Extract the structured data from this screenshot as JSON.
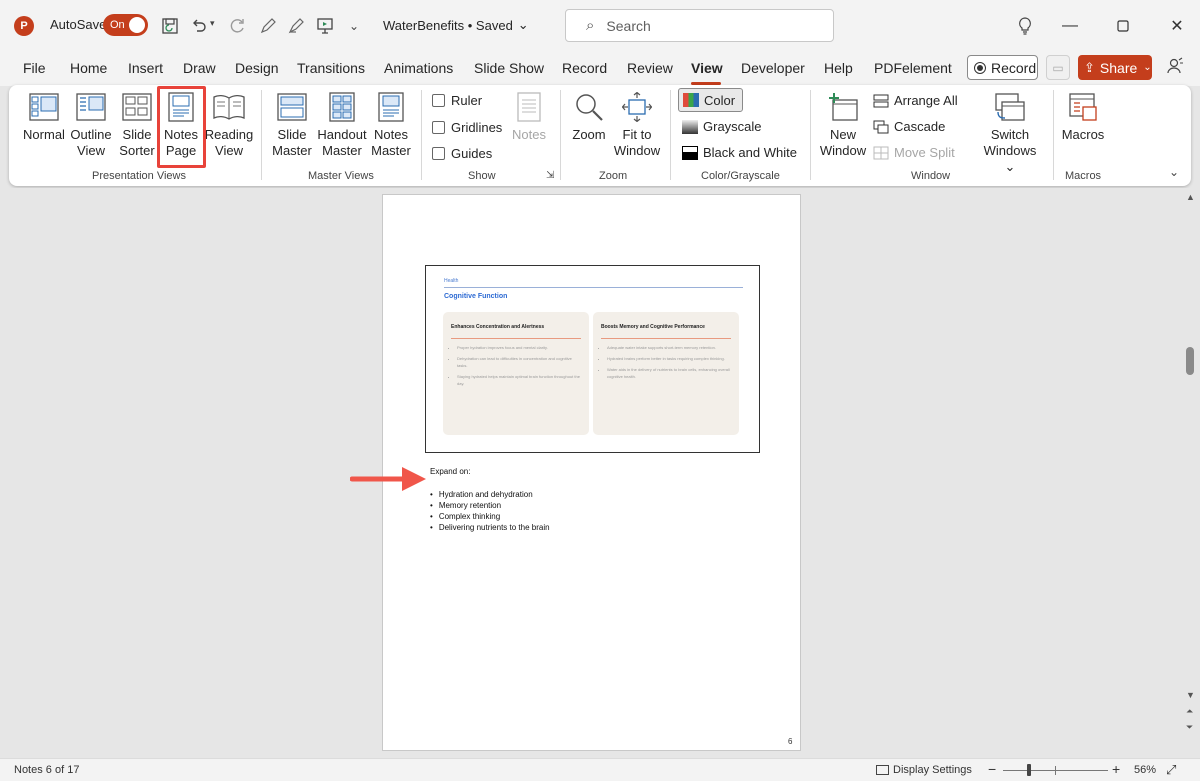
{
  "titlebar": {
    "logo_letter": "P",
    "autosave_label": "AutoSave",
    "autosave_state": "On",
    "doc_title": "WaterBenefits • Saved",
    "title_chevron": "⌄",
    "search_placeholder": "Search",
    "icons": [
      "save-icon",
      "undo-icon",
      "redo-icon",
      "pen-icon",
      "highlighter-icon",
      "present-icon",
      "customize-icon",
      "lightbulb-icon",
      "minimize-icon",
      "maximize-icon",
      "close-icon"
    ]
  },
  "tabs": [
    "File",
    "Home",
    "Insert",
    "Draw",
    "Design",
    "Transitions",
    "Animations",
    "Slide Show",
    "Record",
    "Review",
    "View",
    "Developer",
    "Help",
    "PDFelement"
  ],
  "active_tab": "View",
  "record_button": "Record",
  "share_button": "Share",
  "ribbon": {
    "presentation_views": {
      "label": "Presentation Views",
      "buttons": [
        {
          "l1": "Normal",
          "l2": ""
        },
        {
          "l1": "Outline",
          "l2": "View"
        },
        {
          "l1": "Slide",
          "l2": "Sorter"
        },
        {
          "l1": "Notes",
          "l2": "Page"
        },
        {
          "l1": "Reading",
          "l2": "View"
        }
      ]
    },
    "master_views": {
      "label": "Master Views",
      "buttons": [
        {
          "l1": "Slide",
          "l2": "Master"
        },
        {
          "l1": "Handout",
          "l2": "Master"
        },
        {
          "l1": "Notes",
          "l2": "Master"
        }
      ]
    },
    "show": {
      "label": "Show",
      "checkboxes": [
        "Ruler",
        "Gridlines",
        "Guides"
      ],
      "notes_button": "Notes"
    },
    "zoom": {
      "label": "Zoom",
      "zoom_button": "Zoom",
      "fit_l1": "Fit to",
      "fit_l2": "Window"
    },
    "color_grayscale": {
      "label": "Color/Grayscale",
      "options": [
        "Color",
        "Grayscale",
        "Black and White"
      ]
    },
    "window": {
      "label": "Window",
      "new_l1": "New",
      "new_l2": "Window",
      "arrange_all": "Arrange All",
      "cascade": "Cascade",
      "move_split": "Move Split",
      "switch_l1": "Switch",
      "switch_l2": "Windows ⌄"
    },
    "macros": {
      "label": "Macros",
      "button": "Macros"
    }
  },
  "notes_page": {
    "slide": {
      "section": "Health",
      "title": "Cognitive Function",
      "cards": [
        {
          "title": "Enhances Concentration and Alertness",
          "items": [
            "Proper hydration improves focus and mental clarity.",
            "Dehydration can lead to difficulties in concentration and cognitive tasks.",
            "Staying hydrated helps maintain optimal brain function throughout the day."
          ]
        },
        {
          "title": "Boosts Memory and Cognitive Performance",
          "items": [
            "Adequate water intake supports short-term memory retention.",
            "Hydrated brains perform better in tasks requiring complex thinking.",
            "Water aids in the delivery of nutrients to brain cells, enhancing overall cognitive health."
          ]
        }
      ]
    },
    "notes_heading": "Expand on:",
    "notes_items": [
      "Hydration and dehydration",
      "Memory retention",
      "Complex thinking",
      "Delivering nutrients to the brain"
    ],
    "page_number": "6"
  },
  "statusbar": {
    "slide_info": "Notes 6 of 17",
    "display_settings": "Display Settings",
    "zoom_minus": "−",
    "zoom_plus": "+",
    "zoom_level": "56%",
    "zoom_fraction": 0.25
  },
  "colors": {
    "accent": "#c43e1c",
    "highlight_box": "#e8433a",
    "arrow": "#f0564a"
  }
}
